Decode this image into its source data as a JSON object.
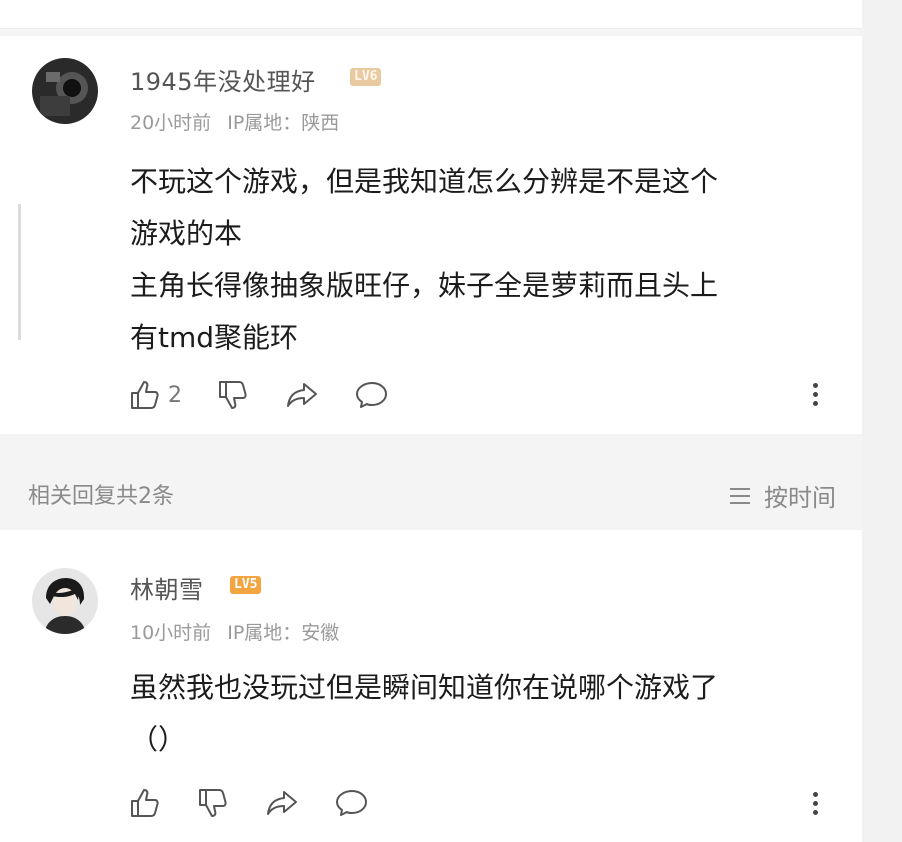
{
  "main_comment": {
    "username": "1945年没处理好",
    "level_badge": "LV6",
    "time": "20小时前",
    "ip_label": "IP属地：",
    "ip_location": "陕西",
    "content_lines": [
      "不玩这个游戏，但是我知道怎么分辨是不是这个",
      "游戏的本",
      "主角长得像抽象版旺仔，妹子全是萝莉而且头上",
      "有tmd聚能环"
    ],
    "like_count": "2",
    "icons": [
      "like-icon",
      "dislike-icon",
      "share-icon",
      "comment-icon",
      "more-icon"
    ]
  },
  "replies_header": {
    "title": "相关回复共2条",
    "sort_label": "按时间",
    "sort_icon": "menu-icon"
  },
  "reply": {
    "username": "林朝雪",
    "level_badge": "LV5",
    "time": "10小时前",
    "ip_label": "IP属地：",
    "ip_location": "安徽",
    "content_lines": [
      "虽然我也没玩过但是瞬间知道你在说哪个游戏了",
      "（）"
    ],
    "icons": [
      "like-icon",
      "dislike-icon",
      "share-icon",
      "comment-icon",
      "more-icon"
    ]
  },
  "colors": {
    "lv6_badge": "#e8c9a0",
    "lv5_badge": "#f2a541",
    "text": "#1c1c1c",
    "meta": "#9a9a9a"
  }
}
